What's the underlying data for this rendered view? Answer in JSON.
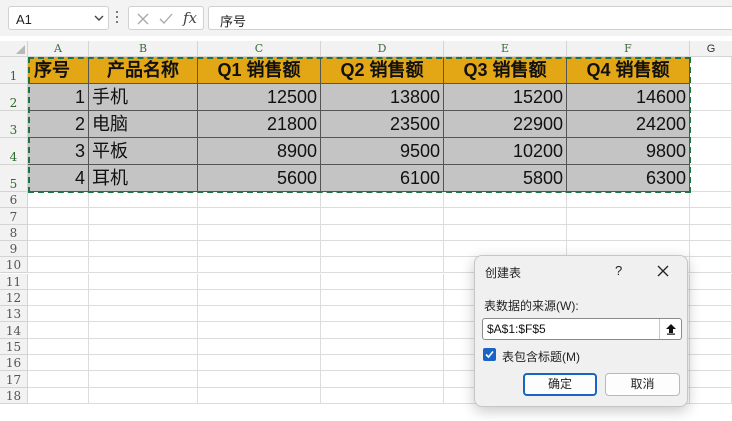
{
  "formula_bar": {
    "name_box": "A1",
    "formula": "序号",
    "fx_label": "fx"
  },
  "columns": [
    "A",
    "B",
    "C",
    "D",
    "E",
    "F",
    "G"
  ],
  "rows": [
    "1",
    "2",
    "3",
    "4",
    "5",
    "6",
    "7",
    "8",
    "9",
    "10",
    "11",
    "12",
    "13",
    "14",
    "15",
    "16",
    "17",
    "18"
  ],
  "table": {
    "headers": [
      "序号",
      "产品名称",
      "Q1 销售额",
      "Q2 销售额",
      "Q3 销售额",
      "Q4 销售额"
    ],
    "rows": [
      [
        "1",
        "手机",
        "12500",
        "13800",
        "15200",
        "14600"
      ],
      [
        "2",
        "电脑",
        "21800",
        "23500",
        "22900",
        "24200"
      ],
      [
        "3",
        "平板",
        "8900",
        "9500",
        "10200",
        "9800"
      ],
      [
        "4",
        "耳机",
        "5600",
        "6100",
        "5800",
        "6300"
      ]
    ],
    "header_color": "#E3A615",
    "body_color": "#C4C4C4",
    "selection_color": "#217346"
  },
  "dialog": {
    "title": "创建表",
    "help": "?",
    "range_label": "表数据的来源(W):",
    "range_value": "$A$1:$F$5",
    "has_headers_label": "表包含标题(M)",
    "has_headers_checked": true,
    "ok_label": "确定",
    "cancel_label": "取消",
    "accent_color": "#1A64C4"
  }
}
